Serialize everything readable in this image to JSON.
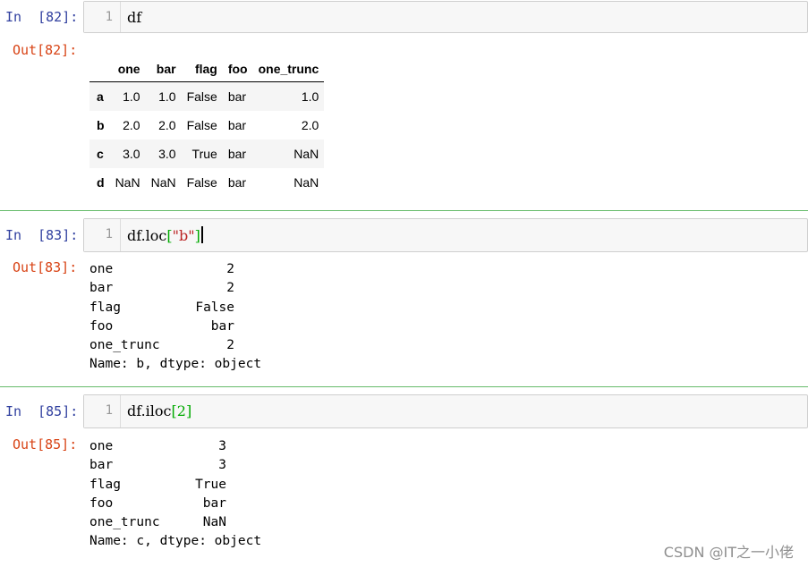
{
  "cells": [
    {
      "in_prompt": "In  [82]:",
      "line_number": "1",
      "code": "df",
      "out_prompt": "Out[82]:",
      "table": {
        "columns": [
          "one",
          "bar",
          "flag",
          "foo",
          "one_trunc"
        ],
        "rows": [
          {
            "index": "a",
            "values": [
              "1.0",
              "1.0",
              "False",
              "bar",
              "1.0"
            ]
          },
          {
            "index": "b",
            "values": [
              "2.0",
              "2.0",
              "False",
              "bar",
              "2.0"
            ]
          },
          {
            "index": "c",
            "values": [
              "3.0",
              "3.0",
              "True",
              "bar",
              "NaN"
            ]
          },
          {
            "index": "d",
            "values": [
              "NaN",
              "NaN",
              "False",
              "bar",
              "NaN"
            ]
          }
        ]
      }
    },
    {
      "in_prompt": "In  [83]:",
      "line_number": "1",
      "code_prefix": "df.loc",
      "code_bracket_open": "[",
      "code_string": "\"b\"",
      "code_bracket_close": "]",
      "out_prompt": "Out[83]:",
      "series": [
        {
          "key": "one",
          "value": "2"
        },
        {
          "key": "bar",
          "value": "2"
        },
        {
          "key": "flag",
          "value": "False"
        },
        {
          "key": "foo",
          "value": "bar"
        },
        {
          "key": "one_trunc",
          "value": "2"
        }
      ],
      "footer": "Name: b, dtype: object"
    },
    {
      "in_prompt": "In  [85]:",
      "line_number": "1",
      "code_prefix": "df.iloc",
      "code_bracket_open": "[",
      "code_number": "2",
      "code_bracket_close": "]",
      "out_prompt": "Out[85]:",
      "series": [
        {
          "key": "one",
          "value": "3"
        },
        {
          "key": "bar",
          "value": "3"
        },
        {
          "key": "flag",
          "value": "True"
        },
        {
          "key": "foo",
          "value": "bar"
        },
        {
          "key": "one_trunc",
          "value": "NaN"
        }
      ],
      "footer": "Name: c, dtype: object"
    }
  ],
  "watermark": "CSDN @IT之一小佬",
  "colors": {
    "in_prompt": "#303f9f",
    "out_prompt": "#d84315",
    "bracket": "#00aa00",
    "string": "#ba2121",
    "divider": "#66bb6a"
  }
}
